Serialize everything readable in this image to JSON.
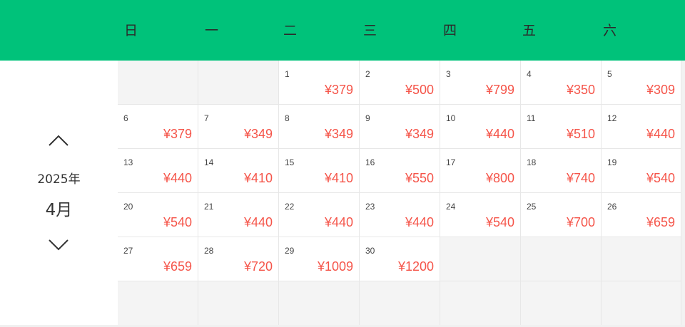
{
  "weekdays": [
    "日",
    "一",
    "二",
    "三",
    "四",
    "五",
    "六"
  ],
  "nav": {
    "year": "2025年",
    "month": "4月"
  },
  "colors": {
    "header": "#00c27a",
    "price": "#f5554a",
    "empty_cell": "#f4f4f4"
  },
  "icons": {
    "prev": "chevron-up-icon",
    "next": "chevron-down-icon"
  },
  "calendar": {
    "weeks": [
      [
        {
          "day": "",
          "price": ""
        },
        {
          "day": "",
          "price": ""
        },
        {
          "day": "1",
          "price": "¥379"
        },
        {
          "day": "2",
          "price": "¥500"
        },
        {
          "day": "3",
          "price": "¥799"
        },
        {
          "day": "4",
          "price": "¥350"
        },
        {
          "day": "5",
          "price": "¥309"
        }
      ],
      [
        {
          "day": "6",
          "price": "¥379"
        },
        {
          "day": "7",
          "price": "¥349"
        },
        {
          "day": "8",
          "price": "¥349"
        },
        {
          "day": "9",
          "price": "¥349"
        },
        {
          "day": "10",
          "price": "¥440"
        },
        {
          "day": "11",
          "price": "¥510"
        },
        {
          "day": "12",
          "price": "¥440"
        }
      ],
      [
        {
          "day": "13",
          "price": "¥440"
        },
        {
          "day": "14",
          "price": "¥410"
        },
        {
          "day": "15",
          "price": "¥410"
        },
        {
          "day": "16",
          "price": "¥550"
        },
        {
          "day": "17",
          "price": "¥800"
        },
        {
          "day": "18",
          "price": "¥740"
        },
        {
          "day": "19",
          "price": "¥540"
        }
      ],
      [
        {
          "day": "20",
          "price": "¥540"
        },
        {
          "day": "21",
          "price": "¥440"
        },
        {
          "day": "22",
          "price": "¥440"
        },
        {
          "day": "23",
          "price": "¥440"
        },
        {
          "day": "24",
          "price": "¥540"
        },
        {
          "day": "25",
          "price": "¥700"
        },
        {
          "day": "26",
          "price": "¥659"
        }
      ],
      [
        {
          "day": "27",
          "price": "¥659"
        },
        {
          "day": "28",
          "price": "¥720"
        },
        {
          "day": "29",
          "price": "¥1009"
        },
        {
          "day": "30",
          "price": "¥1200"
        },
        {
          "day": "",
          "price": ""
        },
        {
          "day": "",
          "price": ""
        },
        {
          "day": "",
          "price": ""
        }
      ],
      [
        {
          "day": "",
          "price": ""
        },
        {
          "day": "",
          "price": ""
        },
        {
          "day": "",
          "price": ""
        },
        {
          "day": "",
          "price": ""
        },
        {
          "day": "",
          "price": ""
        },
        {
          "day": "",
          "price": ""
        },
        {
          "day": "",
          "price": ""
        }
      ]
    ]
  }
}
